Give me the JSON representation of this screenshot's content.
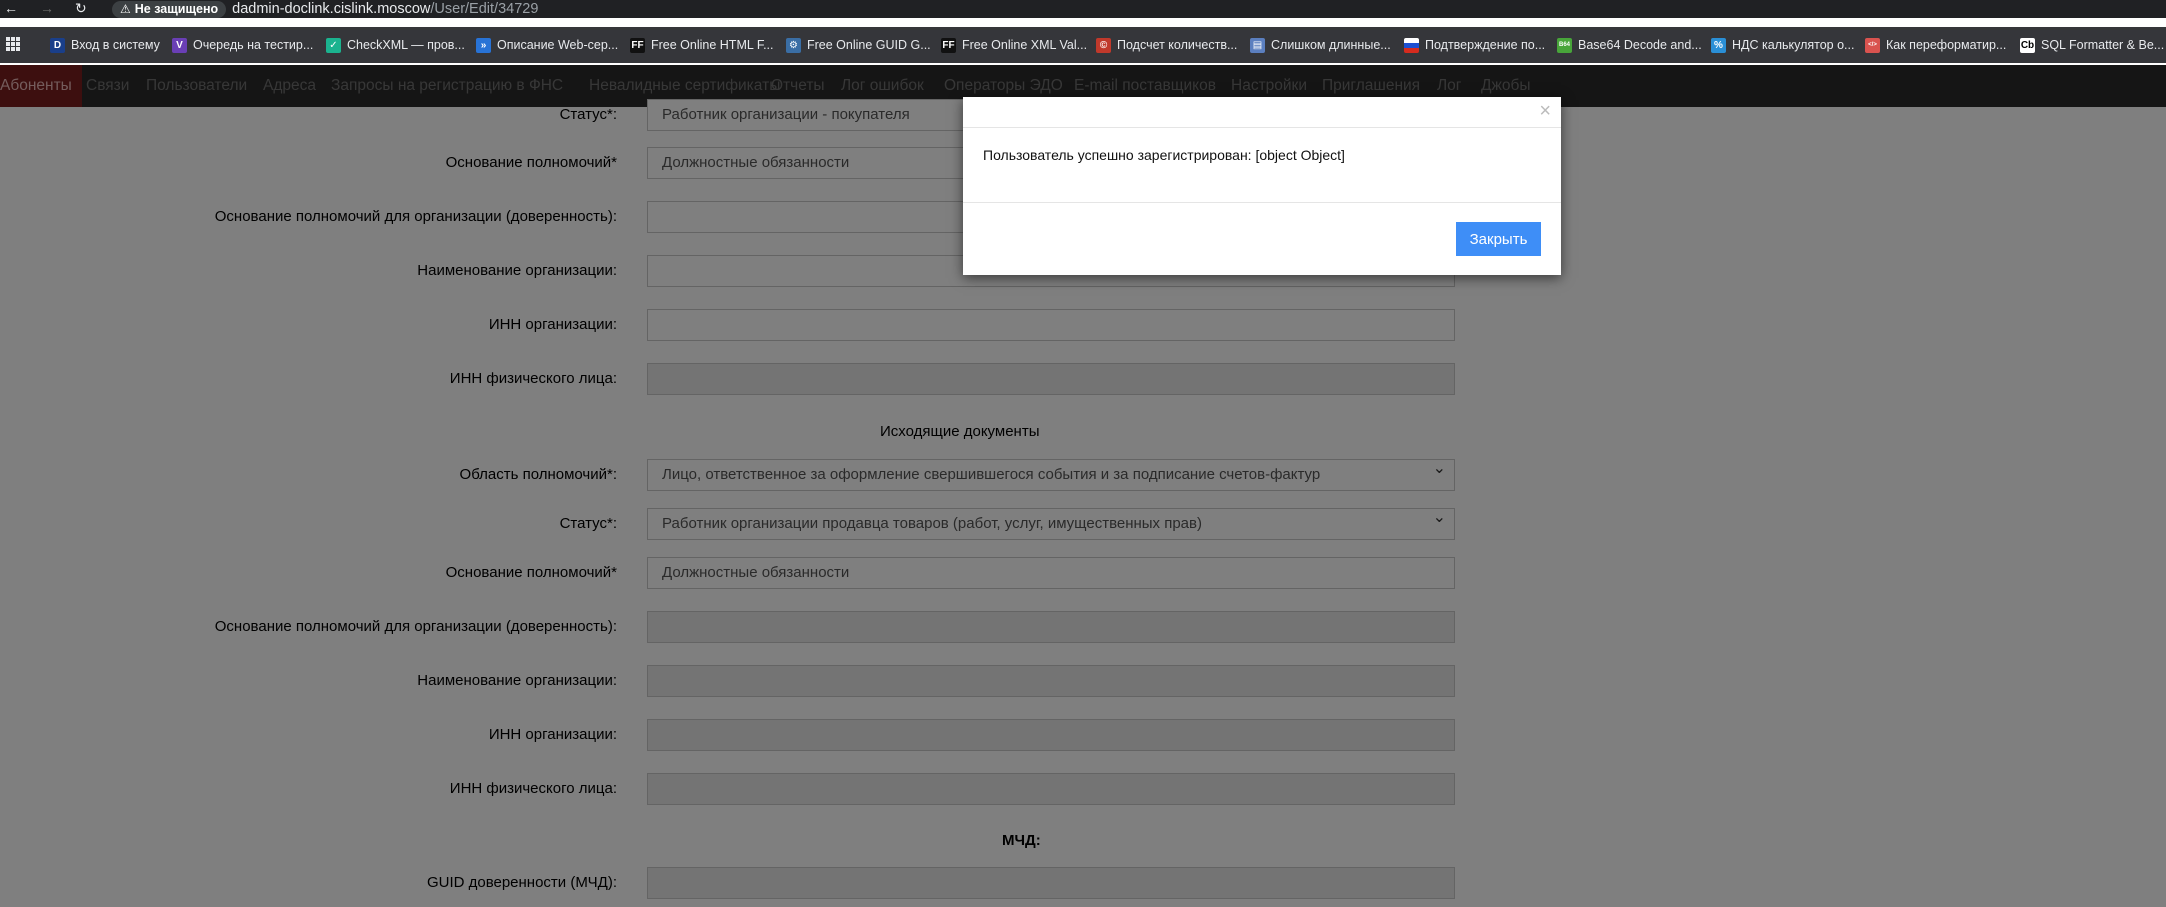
{
  "browser": {
    "security_label": "Не защищено",
    "url_host": "dadmin-doclink.cislink.moscow",
    "url_path": "/User/Edit/34729",
    "bookmarks": [
      {
        "label": "Вход в систему",
        "icon": "d-letter-icon",
        "color": "#1a3f8a",
        "glyph": "D"
      },
      {
        "label": "Очередь на тестир...",
        "icon": "visual-studio-icon",
        "color": "#6a3fb5",
        "glyph": "V"
      },
      {
        "label": "CheckXML — пров...",
        "icon": "checkxml-icon",
        "color": "#1bb38f",
        "glyph": "✓"
      },
      {
        "label": "Описание Web-сер...",
        "icon": "azure-devops-icon",
        "color": "#2873d6",
        "glyph": "»"
      },
      {
        "label": "Free Online HTML F...",
        "icon": "ff-logo-icon",
        "color": "#111111",
        "glyph": "FF"
      },
      {
        "label": "Free Online GUID G...",
        "icon": "gear-icon",
        "color": "#3a6ea5",
        "glyph": "⚙"
      },
      {
        "label": "Free Online XML Val...",
        "icon": "ff-logo-icon",
        "color": "#111111",
        "glyph": "FF"
      },
      {
        "label": "Подсчет количеств...",
        "icon": "copyright-icon",
        "color": "#c0392b",
        "glyph": "©"
      },
      {
        "label": "Слишком длинные...",
        "icon": "window-icon",
        "color": "#5b7fbf",
        "glyph": "▤"
      },
      {
        "label": "Подтверждение по...",
        "icon": "russian-flag-icon",
        "color": "#ffffff",
        "glyph": ""
      },
      {
        "label": "Base64 Decode and...",
        "icon": "base64-icon",
        "color": "#48a53a",
        "glyph": "B64"
      },
      {
        "label": "НДС калькулятор о...",
        "icon": "calculator-icon",
        "color": "#2a8fd6",
        "glyph": "%"
      },
      {
        "label": "Как переформатир...",
        "icon": "code-icon",
        "color": "#d9534f",
        "glyph": "</>"
      },
      {
        "label": "SQL Formatter & Be...",
        "icon": "cb-logo-icon",
        "color": "#ffffff",
        "glyph": "Cb"
      }
    ]
  },
  "nav": {
    "items": [
      "Абоненты",
      "Связи",
      "Пользователи",
      "Адреса",
      "Запросы на регистрацию в ФНС",
      "Невалидные сертификаты",
      "Отчеты",
      "Лог ошибок",
      "Операторы ЭДО",
      "E-mail поставщиков",
      "Настройки",
      "Приглашения",
      "Лог",
      "Джобы"
    ],
    "active_index": 0
  },
  "form": {
    "top_rows": [
      {
        "label": "Статус*:",
        "value": "Работник организации - покупателя",
        "type": "select",
        "disabled": false
      },
      {
        "label": "Основание полномочий*",
        "value": "Должностные обязанности",
        "type": "input",
        "disabled": false
      },
      {
        "label": "Основание полномочий для организации (доверенность):",
        "value": "",
        "type": "input",
        "disabled": false
      },
      {
        "label": "Наименование организации:",
        "value": "",
        "type": "input",
        "disabled": false
      },
      {
        "label": "ИНН организации:",
        "value": "",
        "type": "input",
        "disabled": false
      },
      {
        "label": "ИНН физического лица:",
        "value": "",
        "type": "input",
        "disabled": true
      }
    ],
    "outgoing_title": "Исходящие документы",
    "outgoing_rows": [
      {
        "label": "Область полномочий*:",
        "value": "Лицо, ответственное за оформление свершившегося события и за подписание счетов-фактур",
        "type": "select",
        "disabled": false
      },
      {
        "label": "Статус*:",
        "value": "Работник организации продавца товаров (работ, услуг, имущественных прав)",
        "type": "select",
        "disabled": false
      },
      {
        "label": "Основание полномочий*",
        "value": "Должностные обязанности",
        "type": "input",
        "disabled": false
      },
      {
        "label": "Основание полномочий для организации (доверенность):",
        "value": "",
        "type": "input",
        "disabled": true
      },
      {
        "label": "Наименование организации:",
        "value": "",
        "type": "input",
        "disabled": true
      },
      {
        "label": "ИНН организации:",
        "value": "",
        "type": "input",
        "disabled": true
      },
      {
        "label": "ИНН физического лица:",
        "value": "",
        "type": "input",
        "disabled": true
      }
    ],
    "mchd_title": "МЧД:",
    "mchd_rows": [
      {
        "label": "GUID доверенности (МЧД):",
        "value": "",
        "type": "input",
        "disabled": true
      }
    ]
  },
  "modal": {
    "close_glyph": "×",
    "message": "Пользователь успешно зарегистрирован: [object Object]",
    "ok_label": "Закрыть"
  },
  "colors": {
    "active_tab": "#7a1f1f",
    "primary_button": "#3e8ef7",
    "overlay": "rgba(0,0,0,0.5)"
  }
}
